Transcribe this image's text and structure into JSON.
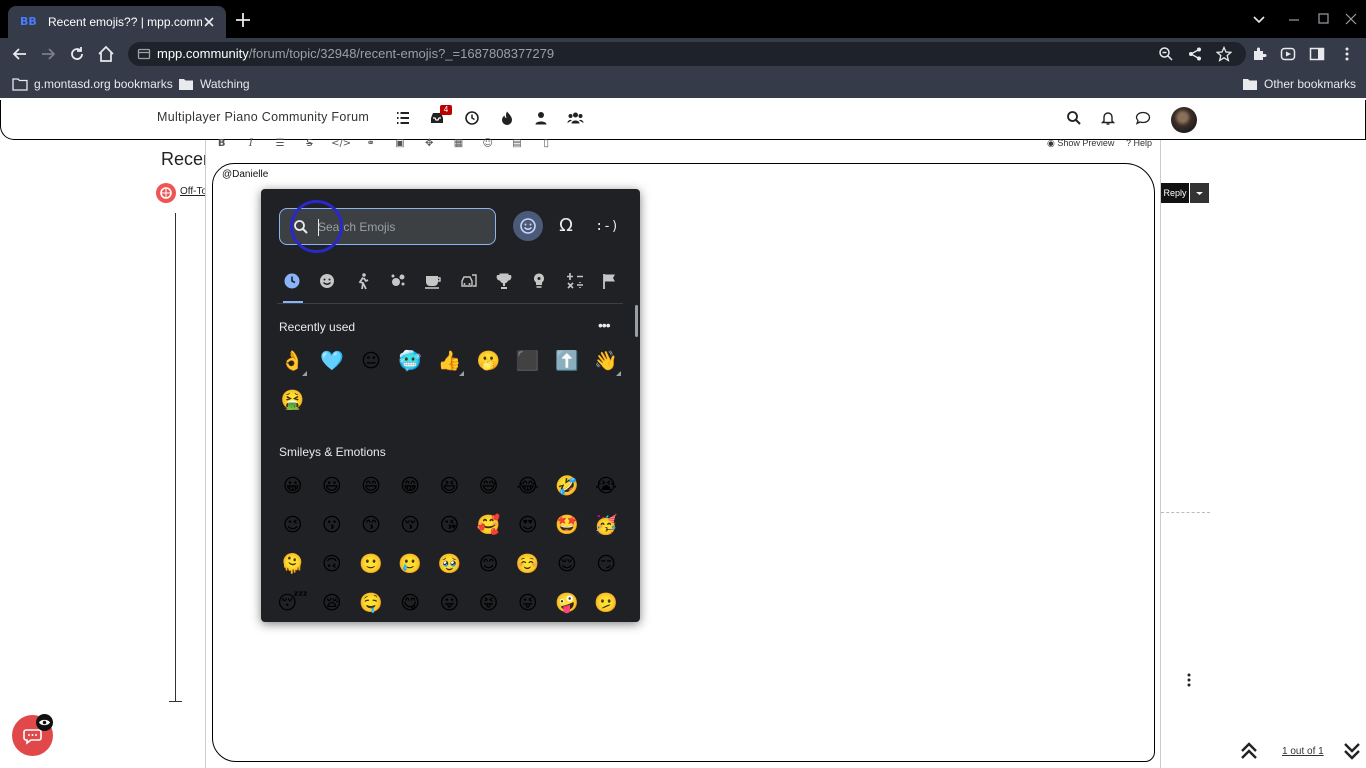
{
  "browser": {
    "tab_title": "Recent emojis?? | mpp.commun",
    "tab_favicon": "BB",
    "url_host": "mpp.community",
    "url_path": "/forum/topic/32948/recent-emojis?_=1687808377279",
    "bookmarks": [
      {
        "label": "g.montasd.org bookmarks",
        "icon": "folder-icon"
      },
      {
        "label": "Watching",
        "icon": "folder-icon"
      }
    ],
    "other_bookmarks": "Other bookmarks"
  },
  "forum": {
    "title": "Multiplayer Piano Community Forum",
    "notification_count": "4",
    "page_title_fragment": "Recen",
    "category_fragment": "Off-Top"
  },
  "composer": {
    "show_preview": "Show Preview",
    "help": "Help",
    "editor_text": "@Danielle",
    "reply": "Reply"
  },
  "pagination": {
    "text": "1 out of 1"
  },
  "emoji_picker": {
    "search_placeholder": "Search Emojis",
    "emoticon_label": ":-)",
    "symbol_label": "Ω",
    "recent_title": "Recently used",
    "recent": [
      "👌",
      "🩵",
      "😐",
      "🥶",
      "👍",
      "🫢",
      "⬛",
      "⬆️",
      "👋",
      "🤮"
    ],
    "recent_variants": [
      0,
      4,
      8
    ],
    "smileys_title": "Smileys & Emotions",
    "smileys": [
      "😀",
      "😃",
      "😄",
      "😁",
      "😆",
      "😅",
      "😂",
      "🤣",
      "😭",
      "😉",
      "😗",
      "😙",
      "😚",
      "😘",
      "🥰",
      "😍",
      "🤩",
      "🥳",
      "🫠",
      "🙃",
      "🙂",
      "🥲",
      "🥹",
      "😊",
      "☺️",
      "😌",
      "😏",
      "😴",
      "😪",
      "🤤",
      "😋",
      "😛",
      "😝",
      "😜",
      "🤪",
      "🫤"
    ]
  },
  "colors": {
    "chrome_bg": "#000000",
    "toolbar_bg": "#353b48",
    "picker_bg": "#202124",
    "accent_blue": "#8ab4f8",
    "focus_ring": "#2a28c8",
    "float_chat": "#e0484a"
  }
}
